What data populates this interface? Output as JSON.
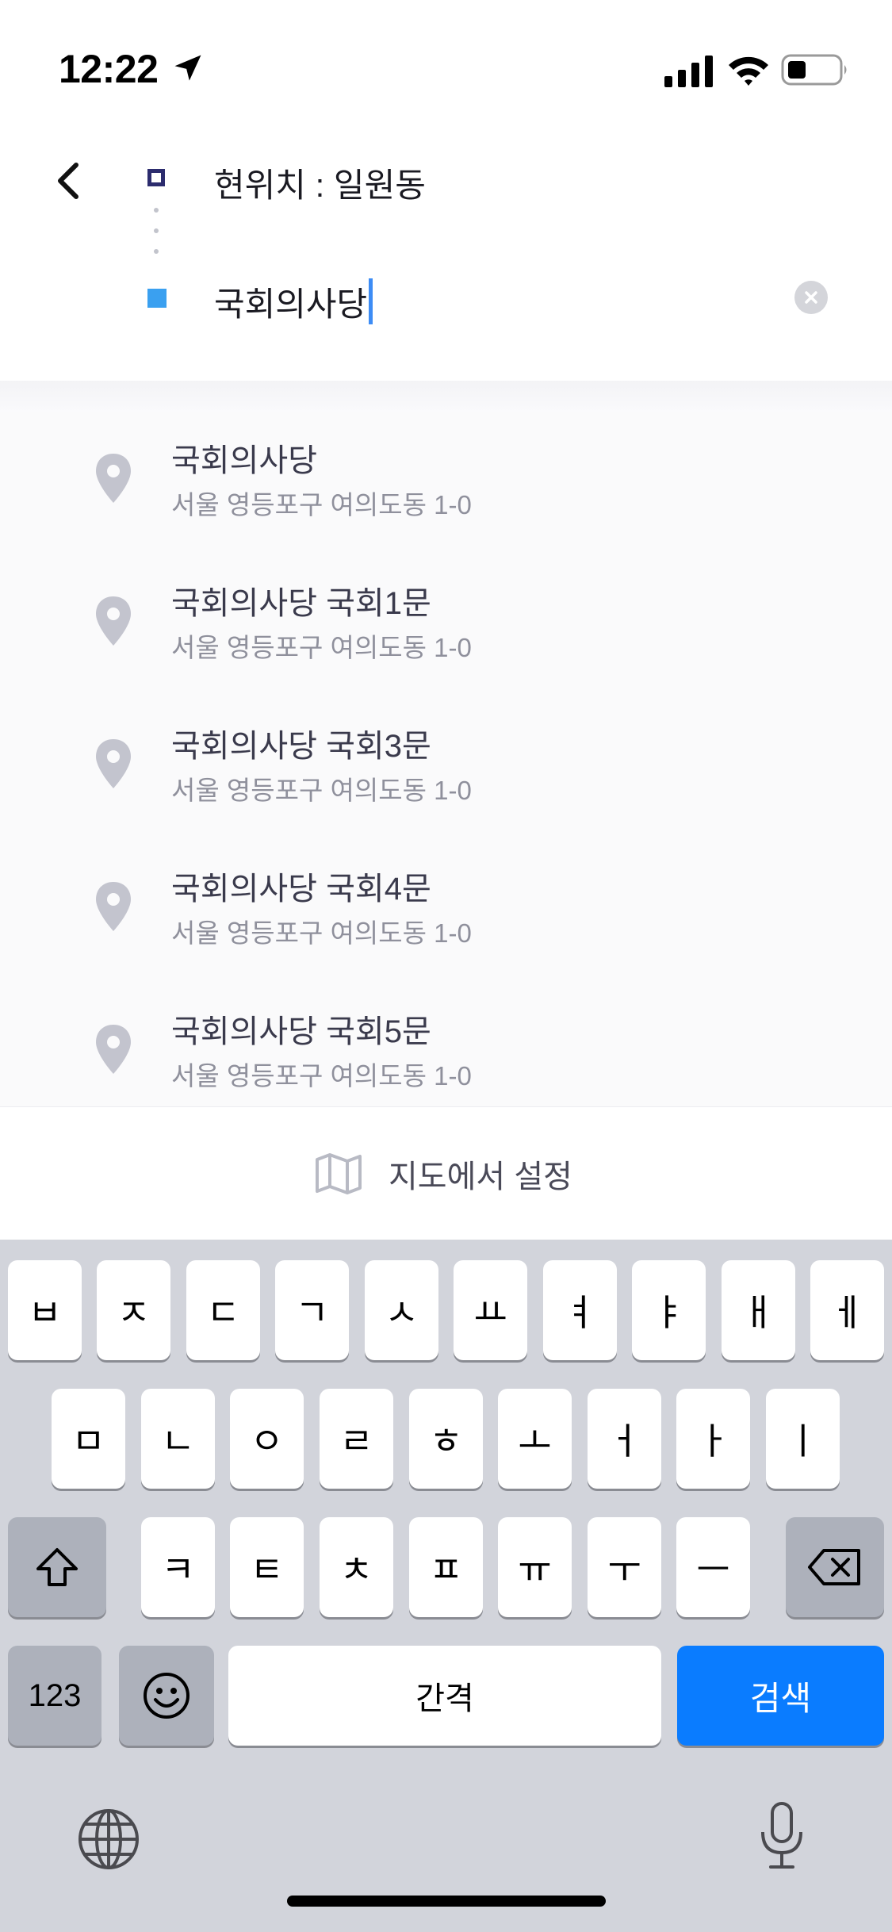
{
  "status_bar": {
    "time": "12:22"
  },
  "search": {
    "origin": "현위치 : 일원동",
    "destination": "국회의사당"
  },
  "results": [
    {
      "name": "국회의사당",
      "address": "서울 영등포구 여의도동 1-0"
    },
    {
      "name": "국회의사당 국회1문",
      "address": "서울 영등포구 여의도동 1-0"
    },
    {
      "name": "국회의사당 국회3문",
      "address": "서울 영등포구 여의도동 1-0"
    },
    {
      "name": "국회의사당 국회4문",
      "address": "서울 영등포구 여의도동 1-0"
    },
    {
      "name": "국회의사당 국회5문",
      "address": "서울 영등포구 여의도동 1-0"
    }
  ],
  "map_setting": {
    "label": "지도에서 설정"
  },
  "keyboard": {
    "row1": [
      "ㅂ",
      "ㅈ",
      "ㄷ",
      "ㄱ",
      "ㅅ",
      "ㅛ",
      "ㅕ",
      "ㅑ",
      "ㅐ",
      "ㅔ"
    ],
    "row2": [
      "ㅁ",
      "ㄴ",
      "ㅇ",
      "ㄹ",
      "ㅎ",
      "ㅗ",
      "ㅓ",
      "ㅏ",
      "ㅣ"
    ],
    "row3": [
      "ㅋ",
      "ㅌ",
      "ㅊ",
      "ㅍ",
      "ㅠ",
      "ㅜ",
      "ㅡ"
    ],
    "numbers_label": "123",
    "space_label": "간격",
    "search_label": "검색"
  },
  "colors": {
    "accent": "#0a7cff",
    "destination_marker": "#3aa0f0",
    "origin_marker": "#2c2c6e",
    "caret": "#3d8cf5"
  },
  "icons": {
    "back": "chevron-left-icon",
    "pin": "location-pin-icon",
    "map": "map-icon",
    "clear": "clear-icon",
    "shift": "shift-icon",
    "delete": "backspace-icon",
    "emoji": "emoji-icon",
    "globe": "globe-icon",
    "mic": "microphone-icon"
  }
}
